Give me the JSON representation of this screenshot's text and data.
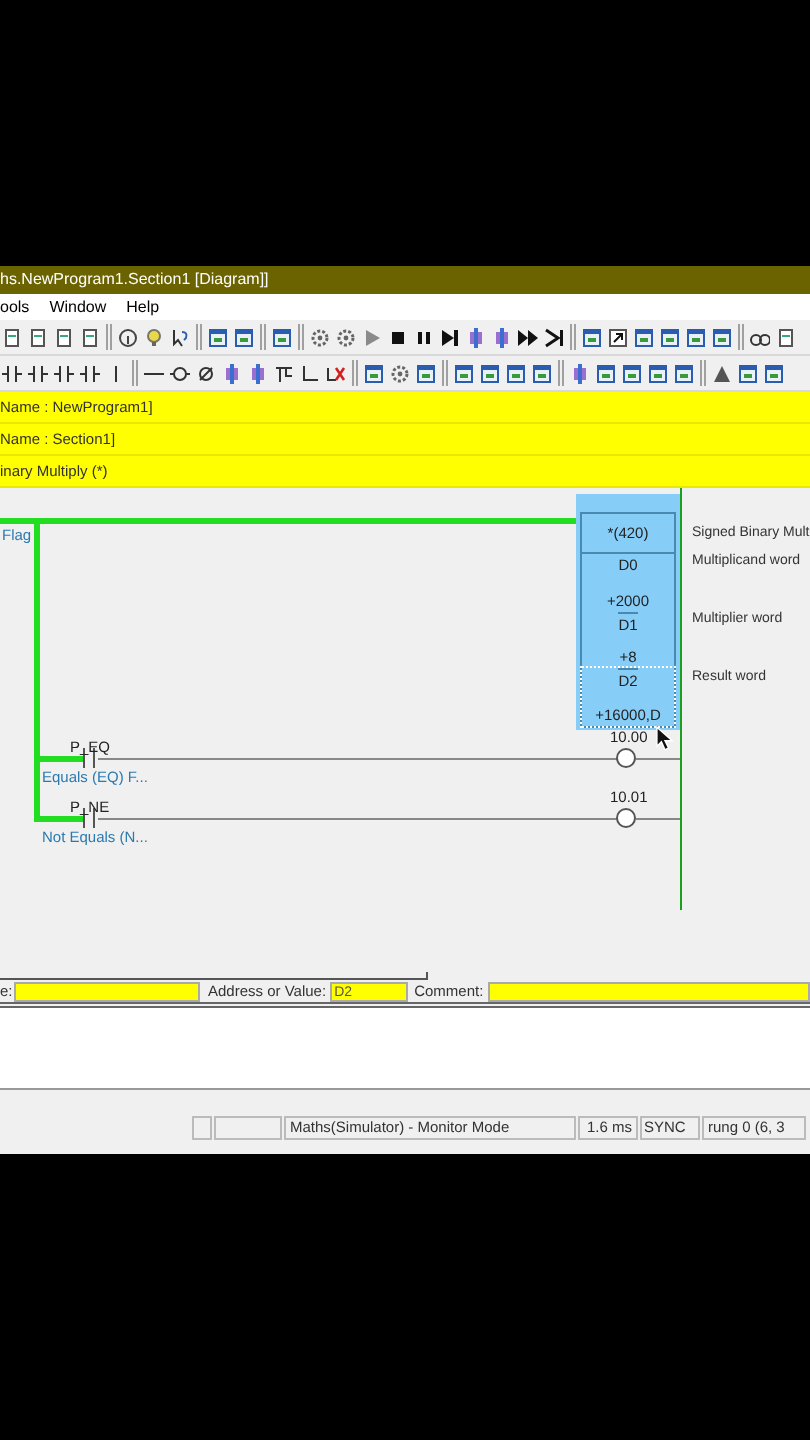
{
  "window": {
    "title": "hs.NewProgram1.Section1 [Diagram]]"
  },
  "menu": [
    "ools",
    "Window",
    "Help"
  ],
  "header_lines": [
    "Name : NewProgram1]",
    "Name : Section1]",
    "inary Multiply (*)"
  ],
  "diagram": {
    "rung_comment": "Flag",
    "instruction": {
      "mnemonic": "*(420)",
      "comment": "Signed Binary Mult",
      "powered": true,
      "operands": [
        {
          "address": "D0",
          "value": "+2000",
          "comment": "Multiplicand word",
          "selected": false
        },
        {
          "address": "D1",
          "value": "+8",
          "comment": "Multiplier word",
          "selected": false
        },
        {
          "address": "D2",
          "value": "+16000,D",
          "comment": "Result word",
          "selected": true
        }
      ]
    },
    "contacts": [
      {
        "address": "P_EQ",
        "comment": "Equals (EQ) F...",
        "coil": "10.00",
        "on": false
      },
      {
        "address": "P_NE",
        "comment": "Not Equals (N...",
        "coil": "10.01",
        "on": false
      }
    ]
  },
  "edit_bar": {
    "name_label": "e:",
    "address_label": "Address or Value:",
    "address_value": "D2",
    "comment_label": "Comment:"
  },
  "status_bar": [
    "Maths(Simulator) - Monitor Mode",
    "1.6 ms",
    "SYNC",
    "rung 0 (6, 3"
  ]
}
